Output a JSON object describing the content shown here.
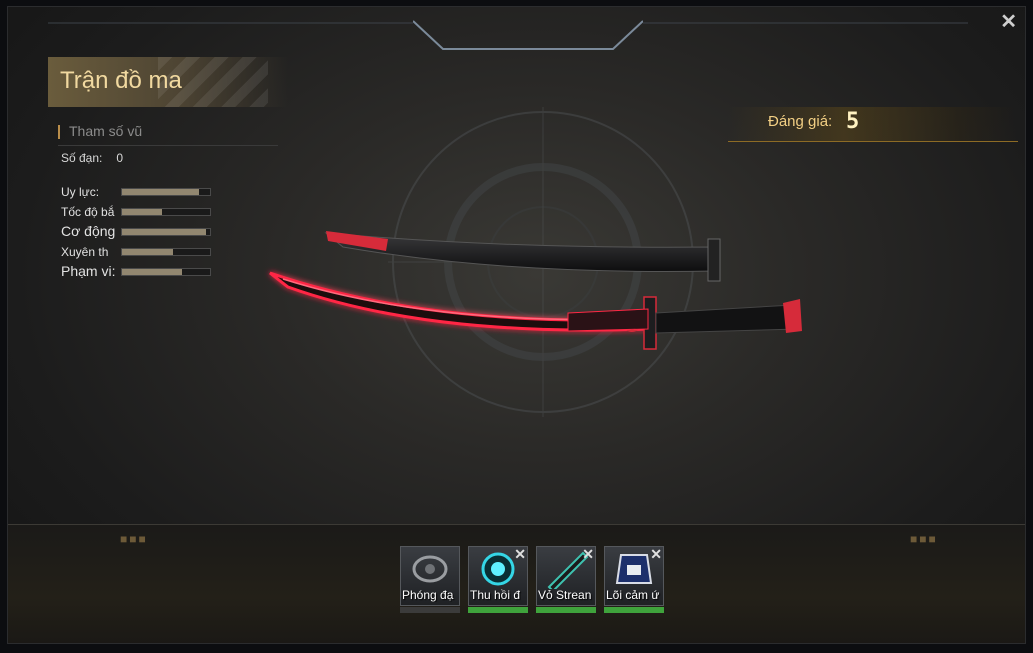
{
  "window": {
    "title": "Trận đồ ma",
    "close_label": "✕"
  },
  "stats_section": {
    "heading": "Tham số vũ",
    "ammo_label": "Số đạn:",
    "ammo_value": "0",
    "stats": [
      {
        "label": "Uy lực:",
        "value": 0.88
      },
      {
        "label": "Tốc độ bắ",
        "value": 0.45
      },
      {
        "label": "Cơ động",
        "value": 0.95
      },
      {
        "label": "Xuyên th",
        "value": 0.58
      },
      {
        "label": "Phạm vi:",
        "value": 0.68
      }
    ]
  },
  "worth": {
    "label": "Đáng giá:",
    "value": "5"
  },
  "attachments": [
    {
      "label": "Phóng đạ",
      "removable": false,
      "bar_color": "#3b3b3b",
      "icon": "scope-icon"
    },
    {
      "label": "Thu hồi đ",
      "removable": true,
      "bar_color": "#3fa33c",
      "icon": "recoil-orb-icon"
    },
    {
      "label": "Vỏ Strean",
      "removable": true,
      "bar_color": "#3fa33c",
      "icon": "sheath-icon"
    },
    {
      "label": "Lõi cảm ứ",
      "removable": true,
      "bar_color": "#3fa33c",
      "icon": "core-sensor-icon"
    }
  ],
  "colors": {
    "gold": "#f2cf84",
    "blade_glow": "#ff2040",
    "active_bar": "#3fa33c"
  }
}
